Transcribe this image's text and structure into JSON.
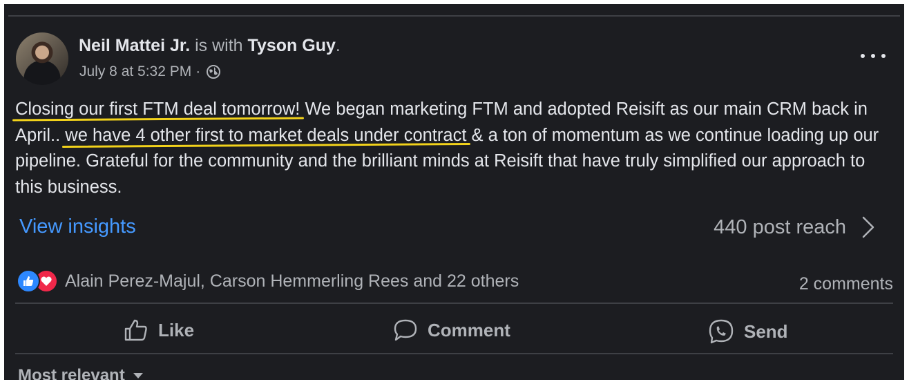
{
  "post": {
    "author": "Neil Mattei Jr.",
    "with_text": "is with",
    "tagged": "Tyson Guy",
    "tagged_suffix": ".",
    "timestamp": "July 8 at 5:32 PM",
    "meta_separator": "·",
    "privacy_icon": "globe-icon",
    "more_icon": "ellipsis-icon",
    "body": {
      "highlight1": "Closing our first FTM deal tomorrow!",
      "text1": " We began marketing FTM and adopted Reisift as our main CRM back in April.. ",
      "highlight2": "we have 4 other first to market deals under contract",
      "text2": " & a ton of momentum as we continue loading up our pipeline. Grateful for the community and the brilliant minds at Reisift that have truly simplified our approach to this business."
    }
  },
  "insights": {
    "link_label": "View insights",
    "reach_label": "440 post reach",
    "chevron_icon": "chevron-right-icon"
  },
  "engagement": {
    "reaction_icons": [
      "like-reaction-icon",
      "love-reaction-icon"
    ],
    "reactors": "Alain Perez-Majul, Carson Hemmerling Rees and 22 others",
    "comments": "2 comments"
  },
  "actions": [
    {
      "label": "Like",
      "icon": "thumbs-up-icon"
    },
    {
      "label": "Comment",
      "icon": "comment-bubble-icon"
    },
    {
      "label": "Send",
      "icon": "messenger-icon"
    }
  ],
  "comments_sort": {
    "label": "Most relevant",
    "icon": "caret-down-icon"
  },
  "colors": {
    "background": "#1c1d21",
    "text_primary": "#e4e6eb",
    "text_secondary": "#b0b3b8",
    "link": "#4599ff",
    "highlight": "#f2d21b",
    "like": "#2d88ff",
    "love": "#f0284a"
  }
}
